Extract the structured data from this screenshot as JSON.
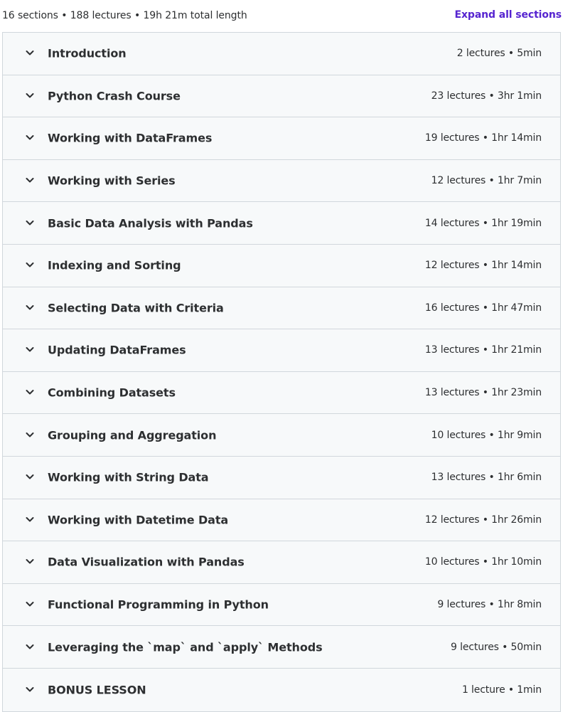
{
  "summary": {
    "text": "16 sections • 188 lectures • 19h 21m total length",
    "expand_label": "Expand all sections"
  },
  "icons": {
    "section_toggle": "chevron-down-icon"
  },
  "colors": {
    "accent": "#5624d0",
    "text": "#2d2f31",
    "section_bg": "#f7f9fa",
    "border": "#d1d7dc"
  },
  "sections": [
    {
      "title": "Introduction",
      "meta": "2 lectures • 5min"
    },
    {
      "title": "Python Crash Course",
      "meta": "23 lectures • 3hr 1min"
    },
    {
      "title": "Working with DataFrames",
      "meta": "19 lectures • 1hr 14min"
    },
    {
      "title": "Working with Series",
      "meta": "12 lectures • 1hr 7min"
    },
    {
      "title": "Basic Data Analysis with Pandas",
      "meta": "14 lectures • 1hr 19min"
    },
    {
      "title": "Indexing and Sorting",
      "meta": "12 lectures • 1hr 14min"
    },
    {
      "title": "Selecting Data with Criteria",
      "meta": "16 lectures • 1hr 47min"
    },
    {
      "title": "Updating DataFrames",
      "meta": "13 lectures • 1hr 21min"
    },
    {
      "title": "Combining Datasets",
      "meta": "13 lectures • 1hr 23min"
    },
    {
      "title": "Grouping and Aggregation",
      "meta": "10 lectures • 1hr 9min"
    },
    {
      "title": "Working with String Data",
      "meta": "13 lectures • 1hr 6min"
    },
    {
      "title": "Working with Datetime Data",
      "meta": "12 lectures • 1hr 26min"
    },
    {
      "title": "Data Visualization with Pandas",
      "meta": "10 lectures • 1hr 10min"
    },
    {
      "title": "Functional Programming in Python",
      "meta": "9 lectures • 1hr 8min"
    },
    {
      "title": "Leveraging the `map` and `apply` Methods",
      "meta": "9 lectures • 50min"
    },
    {
      "title": "BONUS LESSON",
      "meta": "1 lecture • 1min"
    }
  ]
}
